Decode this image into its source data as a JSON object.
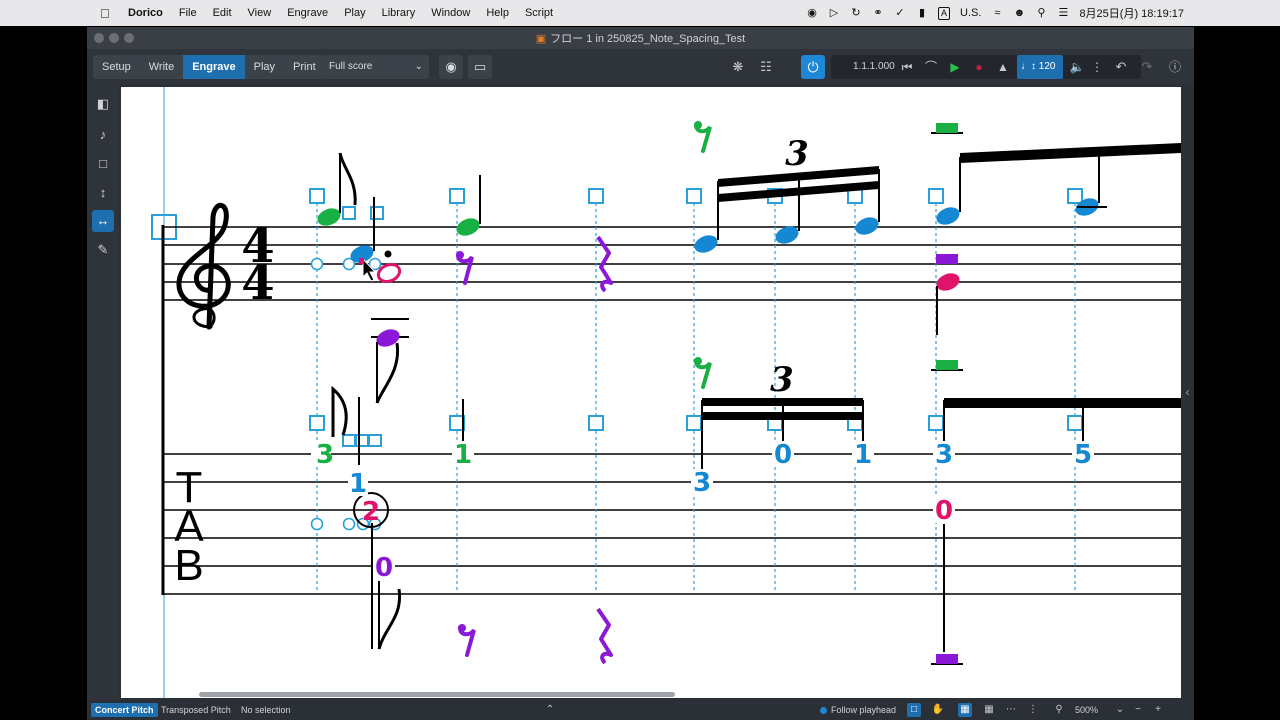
{
  "menubar": {
    "app_name": "Dorico",
    "items": [
      "File",
      "Edit",
      "View",
      "Engrave",
      "Play",
      "Library",
      "Window",
      "Help",
      "Script"
    ],
    "input_source": "A",
    "input_region": "U.S.",
    "datetime": "8月25日(月) 18:19:17"
  },
  "window": {
    "title": "フロー 1 in 250825_Note_Spacing_Test"
  },
  "toolbar": {
    "modes": [
      "Setup",
      "Write",
      "Engrave",
      "Play",
      "Print"
    ],
    "active_mode": "Engrave",
    "layout": "Full score",
    "position": "1.1.1.000",
    "tempo": "120"
  },
  "score": {
    "time_signature_top": "4",
    "time_signature_bottom": "4",
    "tab_letters": [
      "T",
      "A",
      "B"
    ],
    "tuplet_number": "3",
    "tab_numbers": {
      "n1": "3",
      "n2": "1",
      "n3": "2",
      "n4": "0",
      "n5": "1",
      "n6": "3",
      "n7": "0",
      "n8": "1",
      "n9": "3",
      "n10": "5",
      "n11": "0"
    },
    "colors": {
      "voice_green": "#19b043",
      "voice_blue": "#1588d4",
      "voice_purple": "#8a18d6",
      "voice_magenta": "#e0136b",
      "handle_blue": "#2ba0d8"
    }
  },
  "statusbar": {
    "concert_pitch": "Concert Pitch",
    "transposed_pitch": "Transposed Pitch",
    "selection": "No selection",
    "follow_playhead": "Follow playhead",
    "zoom": "500%"
  }
}
